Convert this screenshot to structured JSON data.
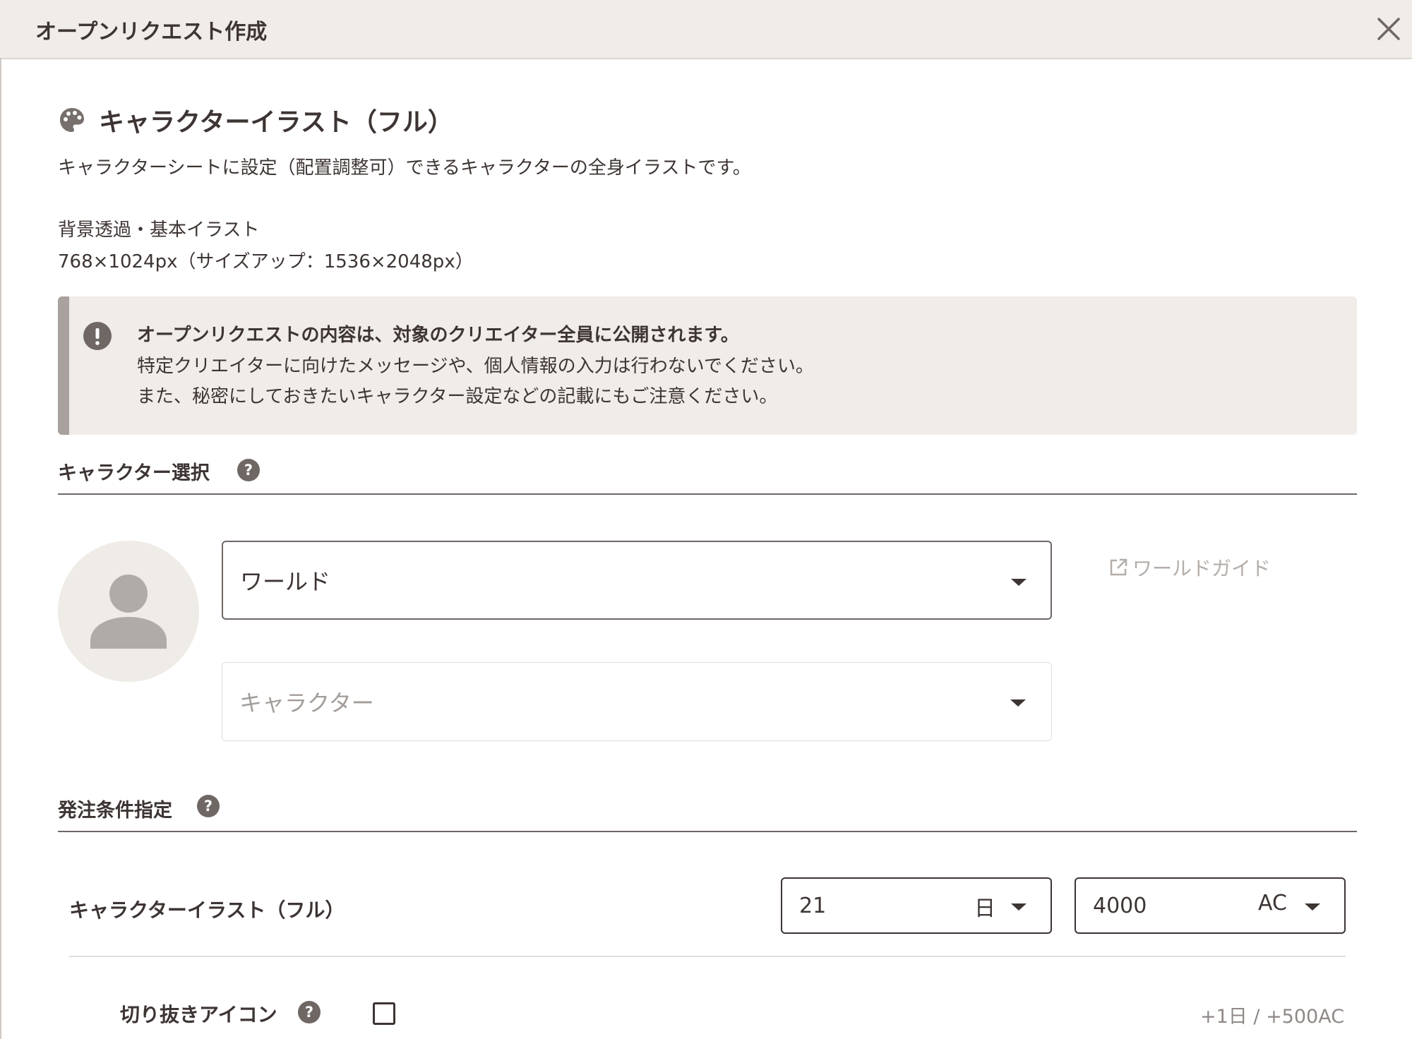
{
  "header": {
    "title": "オープンリクエスト作成"
  },
  "item": {
    "title": "キャラクターイラスト（フル）",
    "description": "キャラクターシートに設定（配置調整可）できるキャラクターの全身イラストです。",
    "spec_line1": "背景透過・基本イラスト",
    "spec_line2": "768×1024px（サイズアップ：1536×2048px）"
  },
  "notice": {
    "headline": "オープンリクエストの内容は、対象のクリエイター全員に公開されます。",
    "line2": "特定クリエイターに向けたメッセージや、個人情報の入力は行わないでください。",
    "line3": "また、秘密にしておきたいキャラクター設定などの記載にもご注意ください。"
  },
  "character_select": {
    "label": "キャラクター選択",
    "world_value": "ワールド",
    "character_placeholder": "キャラクター",
    "world_guide": "ワールドガイド"
  },
  "conditions": {
    "label": "発注条件指定",
    "row_label": "キャラクターイラスト（フル）",
    "days_value": "21",
    "days_unit": "日",
    "price_value": "4000",
    "price_unit": "AC",
    "option_label": "切り抜きアイコン",
    "option_addon": "+1日  /  +500AC"
  },
  "icons": [
    "close-icon",
    "palette-icon",
    "exclamation-icon",
    "help-icon",
    "user-avatar-icon",
    "chevron-down-icon",
    "external-link-icon"
  ],
  "colors": {
    "header_bg": "#f0ece8",
    "notice_bg": "#f0ece8",
    "text": "#3d3533",
    "muted": "#b4aeaa"
  }
}
